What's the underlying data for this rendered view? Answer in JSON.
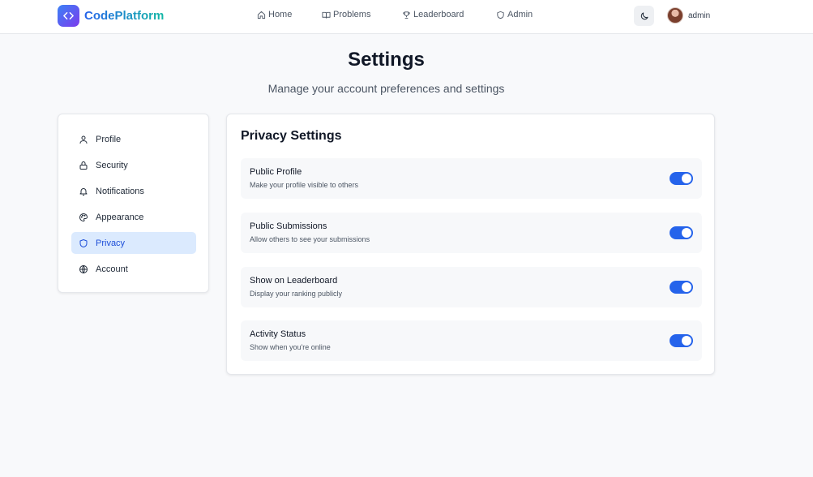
{
  "app": {
    "name": "CodePlatform"
  },
  "nav": {
    "items": [
      {
        "label": "Home",
        "icon": "home-icon"
      },
      {
        "label": "Problems",
        "icon": "book-icon"
      },
      {
        "label": "Leaderboard",
        "icon": "trophy-icon"
      },
      {
        "label": "Admin",
        "icon": "shield-icon"
      }
    ],
    "theme_icon": "moon-icon",
    "user": {
      "name": "admin"
    }
  },
  "header": {
    "title": "Settings",
    "subtitle": "Manage your account preferences and settings"
  },
  "sidebar": {
    "items": [
      {
        "label": "Profile",
        "icon": "user-icon",
        "active": false
      },
      {
        "label": "Security",
        "icon": "lock-icon",
        "active": false
      },
      {
        "label": "Notifications",
        "icon": "bell-icon",
        "active": false
      },
      {
        "label": "Appearance",
        "icon": "palette-icon",
        "active": false
      },
      {
        "label": "Privacy",
        "icon": "shield-icon",
        "active": true
      },
      {
        "label": "Account",
        "icon": "globe-icon",
        "active": false
      }
    ]
  },
  "privacy": {
    "title": "Privacy Settings",
    "settings": [
      {
        "label": "Public Profile",
        "description": "Make your profile visible to others",
        "enabled": true
      },
      {
        "label": "Public Submissions",
        "description": "Allow others to see your submissions",
        "enabled": true
      },
      {
        "label": "Show on Leaderboard",
        "description": "Display your ranking publicly",
        "enabled": true
      },
      {
        "label": "Activity Status",
        "description": "Show when you're online",
        "enabled": true
      }
    ]
  },
  "colors": {
    "accent": "#2563eb",
    "active_bg": "#dbeafe",
    "page_bg": "#f8f9fb"
  }
}
